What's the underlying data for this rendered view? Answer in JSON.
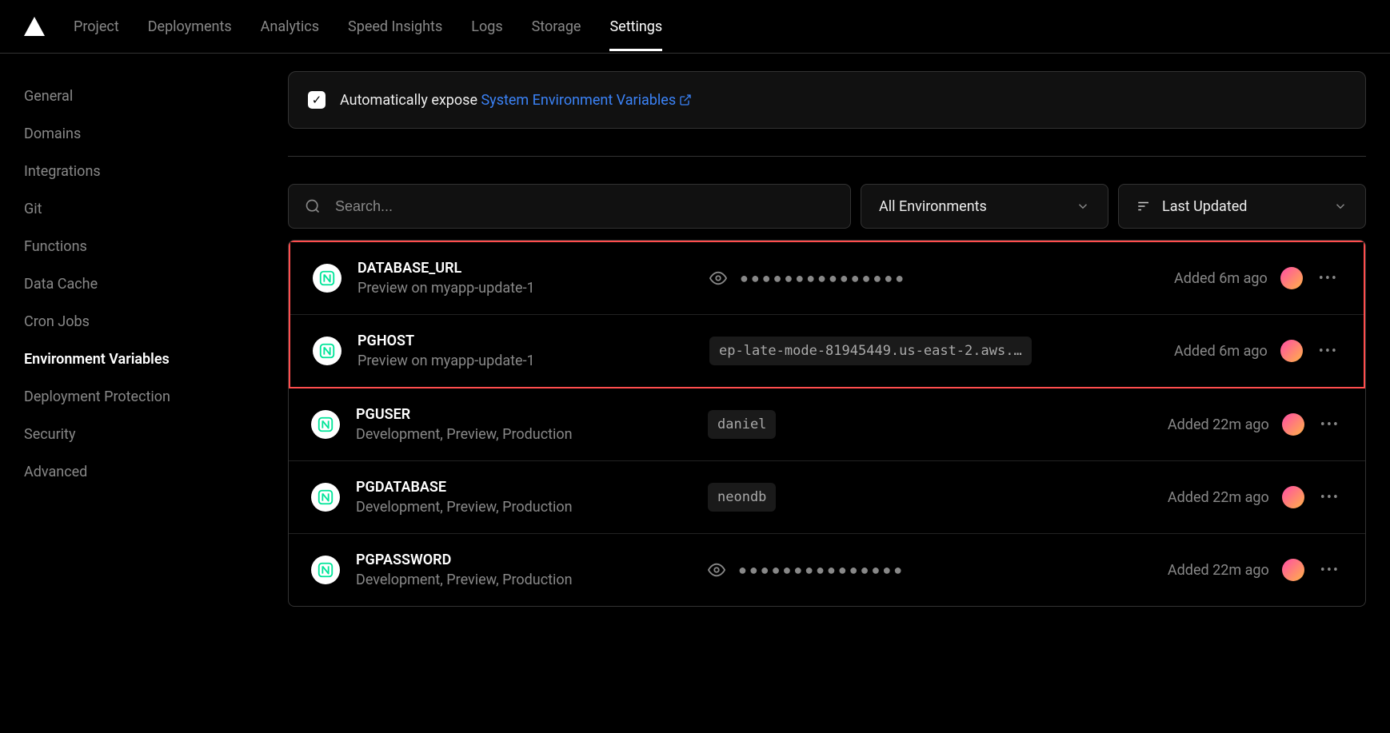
{
  "nav": {
    "items": [
      "Project",
      "Deployments",
      "Analytics",
      "Speed Insights",
      "Logs",
      "Storage",
      "Settings"
    ],
    "active": "Settings"
  },
  "sidebar": {
    "items": [
      "General",
      "Domains",
      "Integrations",
      "Git",
      "Functions",
      "Data Cache",
      "Cron Jobs",
      "Environment Variables",
      "Deployment Protection",
      "Security",
      "Advanced"
    ],
    "active": "Environment Variables"
  },
  "expose": {
    "prefix": "Automatically expose ",
    "link": "System Environment Variables"
  },
  "filters": {
    "search_placeholder": "Search...",
    "env_label": "All Environments",
    "sort_label": "Last Updated"
  },
  "vars": [
    {
      "key": "DATABASE_URL",
      "scope": "Preview on myapp-update-1",
      "masked": true,
      "value": "",
      "added": "Added 6m ago",
      "highlighted": true
    },
    {
      "key": "PGHOST",
      "scope": "Preview on myapp-update-1",
      "masked": false,
      "value": "ep-late-mode-81945449.us-east-2.aws.…",
      "added": "Added 6m ago",
      "highlighted": true
    },
    {
      "key": "PGUSER",
      "scope": "Development, Preview, Production",
      "masked": false,
      "value": "daniel",
      "added": "Added 22m ago",
      "highlighted": false
    },
    {
      "key": "PGDATABASE",
      "scope": "Development, Preview, Production",
      "masked": false,
      "value": "neondb",
      "added": "Added 22m ago",
      "highlighted": false
    },
    {
      "key": "PGPASSWORD",
      "scope": "Development, Preview, Production",
      "masked": true,
      "value": "",
      "added": "Added 22m ago",
      "highlighted": false
    }
  ]
}
